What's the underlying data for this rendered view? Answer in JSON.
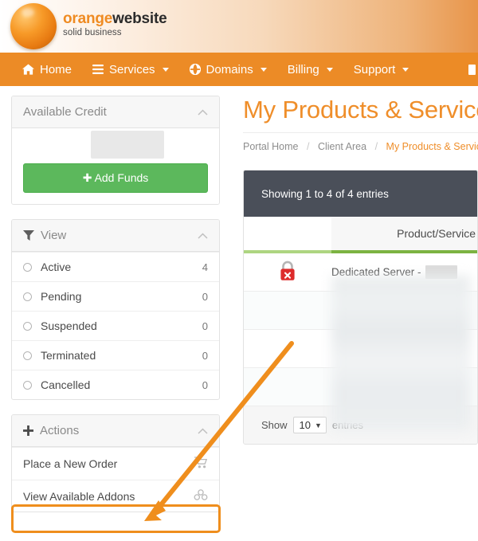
{
  "brand": {
    "logo_primary": "orange",
    "logo_secondary": "website",
    "logo_tagline": "solid business",
    "accent_orange": "#ec8b26",
    "nav_orange": "#ec8b26",
    "title_orange": "#ef8e2a",
    "green_button": "#5cb85c",
    "dark_bar": "#4a4f59",
    "annotation_orange": "#ef8e1d"
  },
  "nav": {
    "items": [
      {
        "label": "Home",
        "icon": "home-icon",
        "has_caret": false
      },
      {
        "label": "Services",
        "icon": "bars-icon",
        "has_caret": true
      },
      {
        "label": "Domains",
        "icon": "globe-icon",
        "has_caret": true
      },
      {
        "label": "Billing",
        "icon": "none",
        "has_caret": true
      },
      {
        "label": "Support",
        "icon": "none",
        "has_caret": true
      }
    ]
  },
  "sidebar": {
    "credit": {
      "title": "Available Credit",
      "amount": "",
      "add_funds_label": "Add Funds",
      "add_funds_icon": "plus-icon",
      "collapse_icon": "chevron-up-icon"
    },
    "view": {
      "title": "View",
      "icon": "filter-icon",
      "collapse_icon": "chevron-up-icon",
      "items": [
        {
          "label": "Active",
          "count": "4"
        },
        {
          "label": "Pending",
          "count": "0"
        },
        {
          "label": "Suspended",
          "count": "0"
        },
        {
          "label": "Terminated",
          "count": "0"
        },
        {
          "label": "Cancelled",
          "count": "0"
        }
      ]
    },
    "actions": {
      "title": "Actions",
      "icon": "plus-icon",
      "collapse_icon": "chevron-up-icon",
      "items": [
        {
          "label": "Place a New Order",
          "icon": "cart-icon"
        },
        {
          "label": "View Available Addons",
          "icon": "cubes-icon"
        }
      ]
    }
  },
  "main": {
    "page_title": "My Products & Services",
    "breadcrumb": [
      {
        "label": "Portal Home",
        "active": false
      },
      {
        "label": "Client Area",
        "active": false
      },
      {
        "label": "My Products & Services",
        "active": true
      }
    ],
    "breadcrumb_separator": "/",
    "table": {
      "showing_text": "Showing 1 to 4 of 4 entries",
      "columns": [
        "",
        "Product/Service"
      ],
      "rows": [
        {
          "status_icon": "lock-error-icon",
          "name": "Dedicated Server -",
          "name_redacted": true
        },
        {
          "status_icon": "",
          "name": "",
          "name_redacted": true
        },
        {
          "status_icon": "",
          "name": "",
          "name_redacted": true
        },
        {
          "status_icon": "",
          "name": "",
          "name_redacted": true
        }
      ],
      "footer": {
        "show_label": "Show",
        "page_size": "10",
        "entries_label": "entries"
      }
    }
  },
  "annotation": {
    "type": "arrow",
    "target": "View Available Addons",
    "color": "#ef8e1d"
  }
}
